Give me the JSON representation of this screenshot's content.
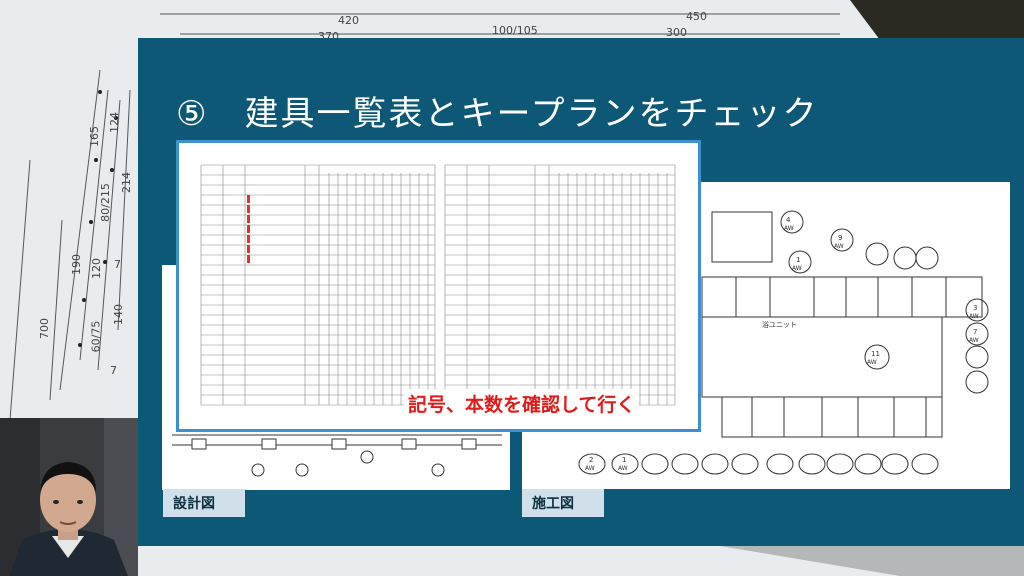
{
  "background_dimensions": {
    "top": [
      "420",
      "450",
      "100/105",
      "300",
      "370"
    ],
    "vertical": [
      "165",
      "124",
      "80/215",
      "214",
      "190",
      "120",
      "7",
      "140",
      "60/75",
      "7",
      "700"
    ]
  },
  "slide": {
    "title": "⑤　建具一覧表とキープランをチェック",
    "callout": "記号、本数を確認して行く",
    "label_left": "設計図",
    "label_right": "施工図"
  },
  "plan_right": {
    "room_label": "浴ユニット",
    "aw_tags": [
      "4",
      "AW",
      "1",
      "AW",
      "9",
      "AW",
      "7",
      "AW",
      "3",
      "AW",
      "11",
      "AW",
      "2",
      "AW",
      "1",
      "AW"
    ]
  },
  "colors": {
    "slide_bg": "#0d5877",
    "highlight_border": "#3d8fd0",
    "callout_text": "#e11a1a"
  }
}
